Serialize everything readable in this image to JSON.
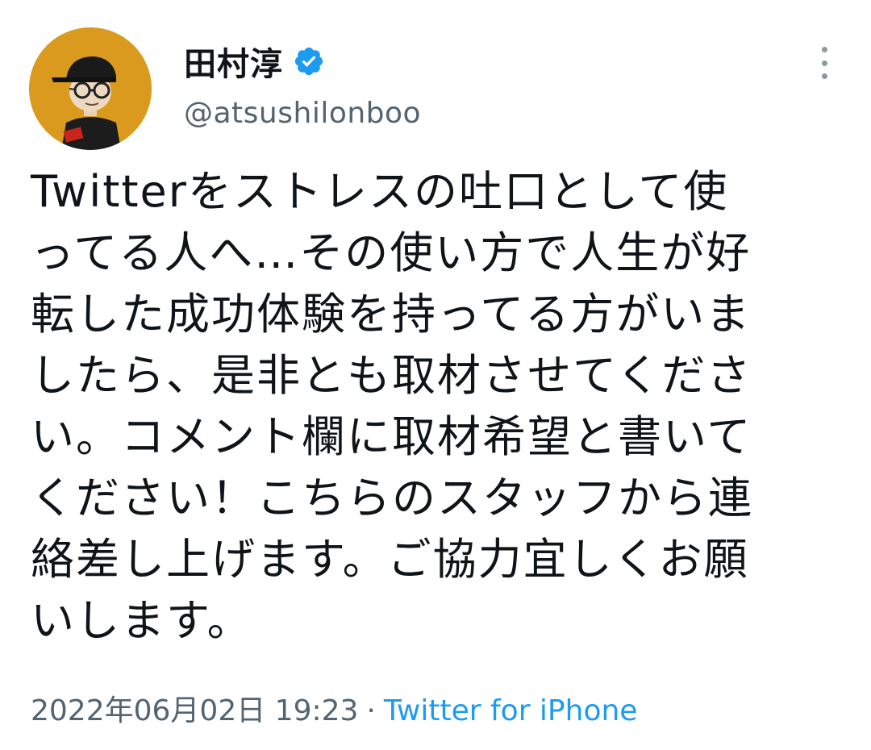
{
  "author": {
    "display_name": "田村淳",
    "handle": "@atsushilonboo",
    "verified": true
  },
  "tweet": {
    "text_lines": [
      "Twitterをストレスの吐口として使",
      "ってる人へ…その使い方で人生が好",
      "転した成功体験を持ってる方がいま",
      "したら、是非とも取材させてくださ",
      "い。コメント欄に取材希望と書いて",
      "ください！こちらのスタッフから連",
      "絡差し上げます。ご協力宜しくお願",
      "いします。"
    ],
    "timestamp": "2022年06月02日 19:23",
    "separator": "·",
    "source": "Twitter for iPhone"
  },
  "icons": {
    "verified": "verified-badge-icon",
    "more": "more-options-icon"
  },
  "colors": {
    "accent": "#1d9bf0",
    "text_primary": "#0f1419",
    "text_secondary": "#536471",
    "avatar_bg": "#d99a1e"
  }
}
